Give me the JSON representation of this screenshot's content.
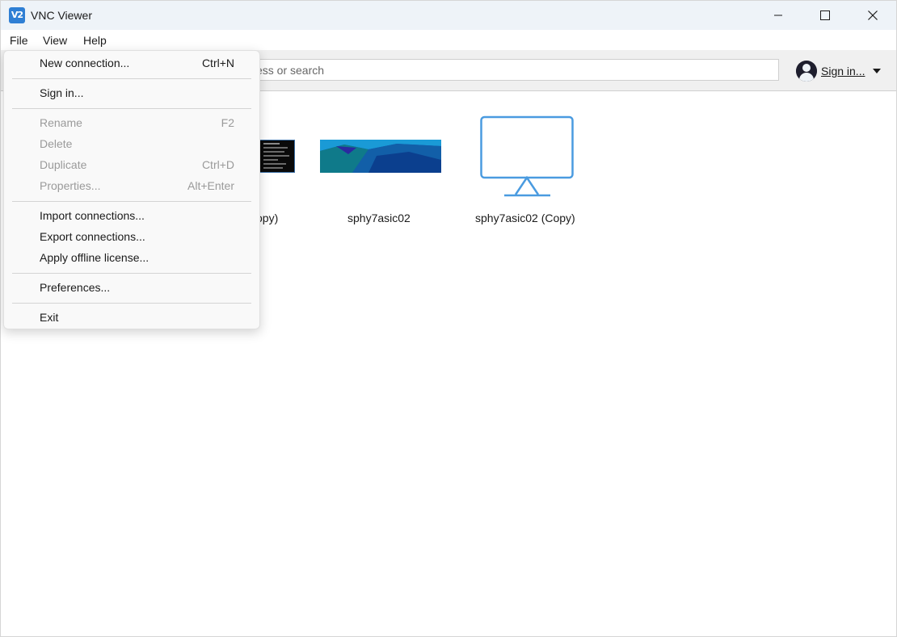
{
  "window": {
    "title": "VNC Viewer",
    "icon": "vnc-icon",
    "icon_text": "V2"
  },
  "menubar": {
    "items": [
      {
        "label": "File"
      },
      {
        "label": "View"
      },
      {
        "label": "Help"
      }
    ]
  },
  "toolbar": {
    "search_visible_text": "ess or search",
    "signin_label": "Sign in..."
  },
  "connections": [
    {
      "label": "opy)",
      "thumbnail": "terminal-thumbnail"
    },
    {
      "label": "sphy7asic02",
      "thumbnail": "desktop-thumbnail"
    },
    {
      "label": "sphy7asic02 (Copy)",
      "thumbnail": "monitor-icon"
    }
  ],
  "file_menu": {
    "items": [
      {
        "label": "New connection...",
        "shortcut": "Ctrl+N",
        "enabled": true
      },
      {
        "label": "Sign in...",
        "shortcut": "",
        "enabled": true
      },
      {
        "label": "Rename",
        "shortcut": "F2",
        "enabled": false
      },
      {
        "label": "Delete",
        "shortcut": "",
        "enabled": false
      },
      {
        "label": "Duplicate",
        "shortcut": "Ctrl+D",
        "enabled": false
      },
      {
        "label": "Properties...",
        "shortcut": "Alt+Enter",
        "enabled": false
      },
      {
        "label": "Import connections...",
        "shortcut": "",
        "enabled": true
      },
      {
        "label": "Export connections...",
        "shortcut": "",
        "enabled": true
      },
      {
        "label": "Apply offline license...",
        "shortcut": "",
        "enabled": true
      },
      {
        "label": "Preferences...",
        "shortcut": "",
        "enabled": true
      },
      {
        "label": "Exit",
        "shortcut": "",
        "enabled": true
      }
    ]
  },
  "colors": {
    "accent": "#2f7fd4",
    "monitor_stroke": "#4a9be0",
    "disabled_text": "#9a9a9a"
  }
}
